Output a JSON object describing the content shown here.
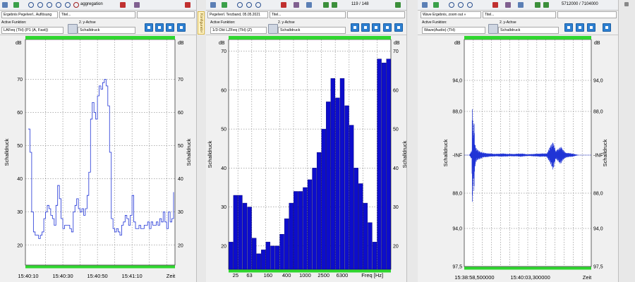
{
  "panels": [
    {
      "toolbar_label": "aggregation",
      "dropdown_left": "Ergebnis Pegelverl., Auflösung",
      "dropdown_right": "Titel...",
      "active_function_label": "Active Funktion:",
      "active_function_value": "LAFeq (TH) (P1 (A, Fast))",
      "y2_label": "2. y-Achse",
      "y2_value": "Schalldruck"
    },
    {
      "dropdown_left": "Pegelverl. Terzband, 05.05.2021",
      "dropdown_right": "Titel...",
      "counter": "119 / 148",
      "active_function_label": "Active Funktion:",
      "active_function_value": "1/3 Okt LZFeq (TH) (Z)",
      "y2_label": "2. y-Achse",
      "y2_value": "Schalldruck"
    },
    {
      "dropdown_left": "Wave Ergebnis, zoom out »",
      "dropdown_right": "Titel...",
      "counter": "5712000 / 7104000",
      "active_function_label": "Active Funktion:",
      "active_function_value": "Wave(Audio) (TH)",
      "y2_label": "2. y-Achse",
      "y2_value": "Schalldruck"
    }
  ],
  "side_tab": "Konfigurator",
  "chart_data": [
    {
      "type": "line",
      "unit_left": "dB",
      "unit_right": "dB",
      "ylabel_left": "Schalldruck",
      "ylabel_right": "Schalldruck",
      "xlabel": "Zeit",
      "ylim": [
        14,
        82
      ],
      "yticks": [
        20,
        30,
        40,
        50,
        60,
        70
      ],
      "xlim": [
        0,
        42
      ],
      "xticks": [
        {
          "pos": 0,
          "label": "15:40:10"
        },
        {
          "pos": 10,
          "label": "15:40:30"
        },
        {
          "pos": 20,
          "label": "15:40:50"
        },
        {
          "pos": 30,
          "label": "15:41:10"
        }
      ],
      "series": [
        {
          "color": "#1f33d6",
          "x": [
            0,
            0.5,
            1,
            1.5,
            2,
            2.5,
            3,
            3.5,
            4,
            4.5,
            5,
            5.5,
            6,
            6.5,
            7,
            7.5,
            8,
            8.5,
            9,
            9.5,
            10,
            10.5,
            11,
            11.5,
            12,
            12.5,
            13,
            13.5,
            14,
            14.5,
            15,
            15.5,
            16,
            16.5,
            17,
            17.5,
            18,
            18.5,
            19,
            19.5,
            20,
            20.5,
            21,
            21.5,
            22,
            22.5,
            23,
            23.5,
            24,
            24.5,
            25,
            25.5,
            26,
            26.5,
            27,
            27.5,
            28,
            28.5,
            29,
            29.5,
            30,
            30.5,
            31,
            31.5,
            32,
            32.5,
            33,
            33.5,
            34,
            34.5,
            35,
            35.5,
            36,
            36.5,
            37,
            37.5,
            38,
            38.5,
            39,
            39.5,
            40,
            40.5,
            41,
            41.5,
            42
          ],
          "y": [
            55,
            48,
            30,
            24,
            23,
            23,
            22,
            23,
            24,
            28,
            30,
            32,
            31,
            29,
            28,
            26,
            32,
            38,
            34,
            28,
            25,
            26,
            26,
            26,
            25,
            24,
            30,
            32,
            34,
            31,
            30,
            31,
            29,
            31,
            35,
            42,
            58,
            63,
            60,
            58,
            65,
            68,
            67,
            69,
            70,
            68,
            62,
            48,
            28,
            25,
            24,
            25,
            24,
            23,
            26,
            27,
            29,
            28,
            26,
            29,
            35,
            27,
            25,
            25,
            26,
            25,
            25,
            26,
            26,
            27,
            25,
            27,
            26,
            26,
            27,
            26,
            28,
            27,
            30,
            27,
            25,
            30,
            27,
            28,
            36
          ]
        }
      ]
    },
    {
      "type": "bar",
      "unit_left": "dB",
      "unit_right": "dB",
      "ylabel_left": "Schalldruck",
      "ylabel_right": "Schalldruck",
      "xlabel": "Freq [Hz]",
      "ylim": [
        14,
        73
      ],
      "yticks": [
        20,
        30,
        40,
        50,
        60,
        70
      ],
      "tick_labels": [
        {
          "index": 1,
          "label": "25"
        },
        {
          "index": 4,
          "label": "63"
        },
        {
          "index": 8,
          "label": "160"
        },
        {
          "index": 12,
          "label": "400"
        },
        {
          "index": 16,
          "label": "1000"
        },
        {
          "index": 20,
          "label": "2500"
        },
        {
          "index": 24,
          "label": "6300"
        }
      ],
      "values": [
        21,
        33,
        33,
        31,
        30,
        22,
        18,
        19,
        21,
        20,
        20,
        23,
        27,
        31,
        34,
        34,
        35,
        37,
        40,
        44,
        50,
        57,
        63,
        58,
        63,
        56,
        51,
        40,
        36,
        31,
        26,
        21,
        68,
        67,
        68
      ],
      "color": "#0d0dcc"
    },
    {
      "type": "line",
      "unit_left": "dB",
      "unit_right": "dB",
      "ylabel_left": "Schalldruck",
      "ylabel_right": "Schalldruck",
      "xlabel": "Zeit",
      "yticks": [
        {
          "pos": 94,
          "label": "94,0"
        },
        {
          "pos": 88,
          "label": "88,0"
        },
        {
          "pos": 0,
          "label": "-INF"
        },
        {
          "pos": -88,
          "label": "88,0"
        },
        {
          "pos": -94,
          "label": "94,0"
        },
        {
          "pos": -97.5,
          "label": "97,5"
        }
      ],
      "xticks": [
        {
          "pos": 0.08,
          "label": "15:38:58,500000"
        },
        {
          "pos": 0.52,
          "label": "15:40:03,300000"
        }
      ],
      "series": [
        {
          "color": "#1f33d6",
          "x": [
            0.0,
            0.04,
            0.06,
            0.065,
            0.07,
            0.075,
            0.08,
            0.085,
            0.09,
            0.1,
            0.12,
            0.15,
            0.2,
            0.25,
            0.3,
            0.35,
            0.4,
            0.45,
            0.5,
            0.55,
            0.6,
            0.65,
            0.7,
            0.72,
            0.74,
            0.76,
            0.78,
            0.8,
            0.85,
            0.9,
            0.95,
            1.0
          ],
          "amp": [
            0.0,
            0.0,
            0.06,
            0.9,
            0.15,
            0.55,
            0.32,
            0.14,
            0.1,
            0.07,
            0.05,
            0.03,
            0.02,
            0.015,
            0.02,
            0.015,
            0.015,
            0.02,
            0.01,
            0.015,
            0.02,
            0.02,
            0.18,
            0.05,
            0.08,
            0.11,
            0.06,
            0.03,
            0.02,
            0.0,
            0.0,
            0.0
          ]
        }
      ]
    }
  ]
}
